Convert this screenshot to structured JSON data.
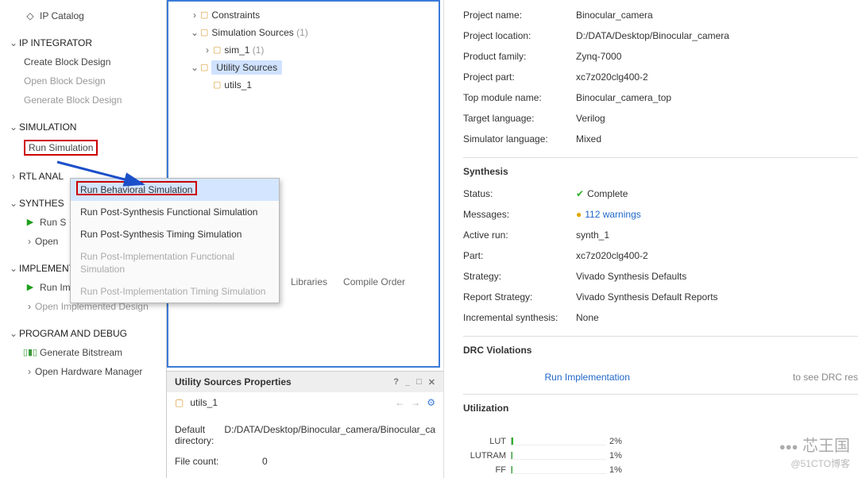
{
  "nav": {
    "ip_catalog": "IP Catalog",
    "ip_integrator": "IP INTEGRATOR",
    "create_bd": "Create Block Design",
    "open_bd": "Open Block Design",
    "gen_bd": "Generate Block Design",
    "simulation": "SIMULATION",
    "run_sim": "Run Simulation",
    "rtl": "RTL ANAL",
    "synth": "SYNTHES",
    "run_s": "Run S",
    "open_s": "Open",
    "impl": "IMPLEMENTATION",
    "run_impl": "Run Implementation",
    "open_impl": "Open Implemented Design",
    "prog": "PROGRAM AND DEBUG",
    "gen_bit": "Generate Bitstream",
    "open_hw": "Open Hardware Manager"
  },
  "tree": {
    "constraints": "Constraints",
    "sim_src": "Simulation Sources",
    "sim_src_count": "(1)",
    "sim1": "sim_1",
    "sim1_count": "(1)",
    "util_src": "Utility Sources",
    "utils1": "utils_1"
  },
  "src_tabs": {
    "lib": "Libraries",
    "comp": "Compile Order"
  },
  "props": {
    "title": "Utility Sources Properties",
    "sel": "utils_1",
    "dir_k": "Default directory:",
    "dir_v": "D:/DATA/Desktop/Binocular_camera/Binocular_ca",
    "cnt_k": "File count:",
    "cnt_v": "0"
  },
  "summary": {
    "name_k": "Project name:",
    "name_v": "Binocular_camera",
    "loc_k": "Project location:",
    "loc_v": "D:/DATA/Desktop/Binocular_camera",
    "fam_k": "Product family:",
    "fam_v": "Zynq-7000",
    "part_k": "Project part:",
    "part_v": "xc7z020clg400-2",
    "top_k": "Top module name:",
    "top_v": "Binocular_camera_top",
    "lang_k": "Target language:",
    "lang_v": "Verilog",
    "simlang_k": "Simulator language:",
    "simlang_v": "Mixed"
  },
  "synth": {
    "title": "Synthesis",
    "status_k": "Status:",
    "status_v": "Complete",
    "msg_k": "Messages:",
    "msg_v": "112 warnings",
    "run_k": "Active run:",
    "run_v": "synth_1",
    "part_k": "Part:",
    "part_v": "xc7z020clg400-2",
    "strat_k": "Strategy:",
    "strat_v": "Vivado Synthesis Defaults",
    "rep_k": "Report Strategy:",
    "rep_v": "Vivado Synthesis Default Reports",
    "inc_k": "Incremental synthesis:",
    "inc_v": "None"
  },
  "drc": {
    "title": "DRC Violations",
    "link": "Run Implementation",
    "note": "to see DRC res"
  },
  "util": {
    "title": "Utilization",
    "bars": [
      {
        "label": "LUT",
        "pct": 2
      },
      {
        "label": "LUTRAM",
        "pct": 1
      },
      {
        "label": "FF",
        "pct": 1
      }
    ]
  },
  "ctx": {
    "items": [
      {
        "label": "Run Behavioral Simulation",
        "state": "sel"
      },
      {
        "label": "Run Post-Synthesis Functional Simulation",
        "state": ""
      },
      {
        "label": "Run Post-Synthesis Timing Simulation",
        "state": ""
      },
      {
        "label": "Run Post-Implementation Functional Simulation",
        "state": "dis"
      },
      {
        "label": "Run Post-Implementation Timing Simulation",
        "state": "dis"
      }
    ]
  },
  "watermark": {
    "main": "芯王国",
    "sub": "@51CTO博客"
  }
}
